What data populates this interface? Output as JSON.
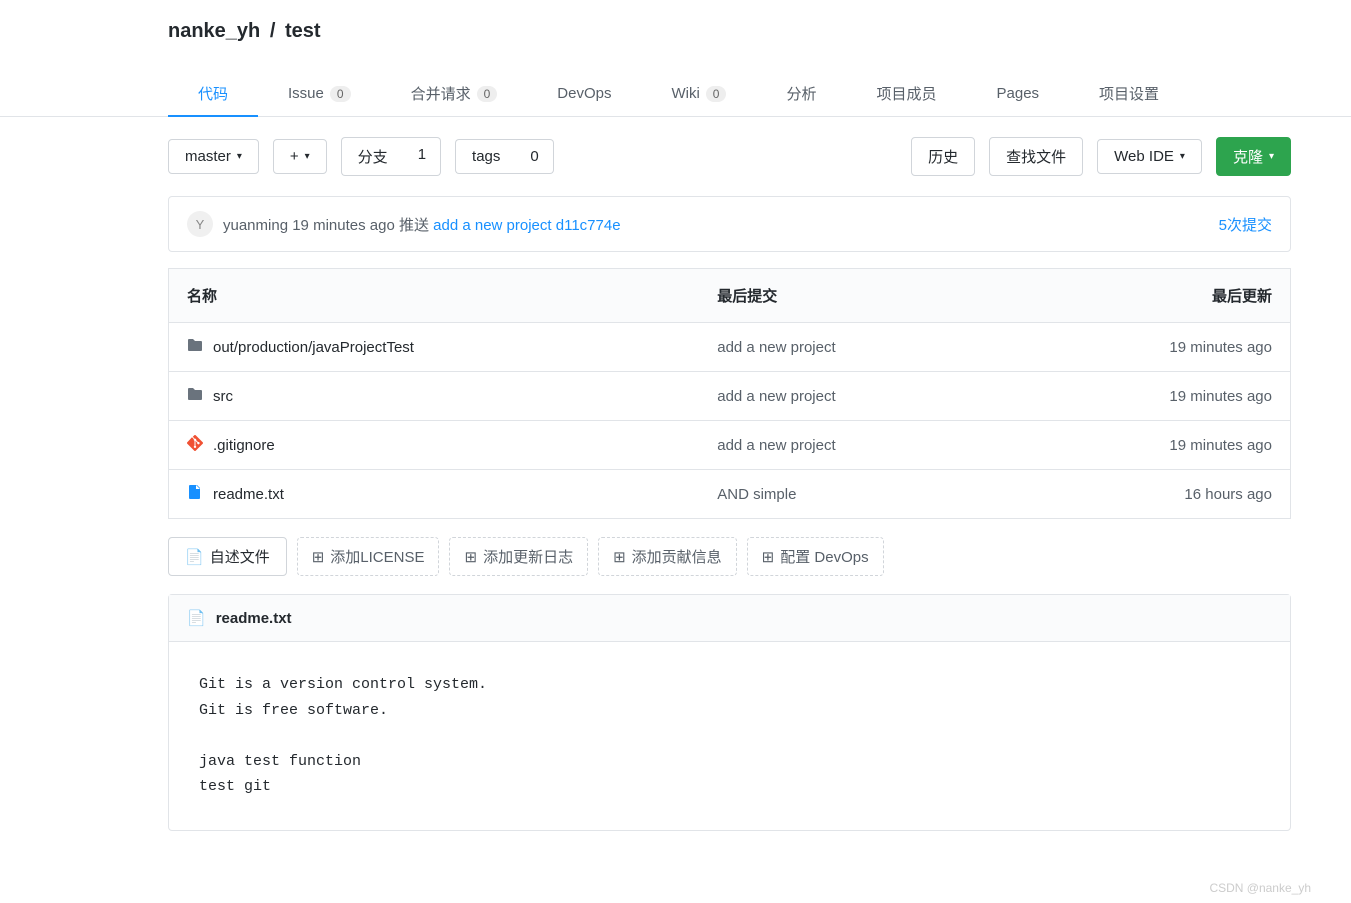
{
  "breadcrumb": {
    "owner": "nanke_yh",
    "sep": "/",
    "repo": "test"
  },
  "tabs": [
    {
      "label": "代码",
      "badge": null,
      "active": true
    },
    {
      "label": "Issue",
      "badge": "0"
    },
    {
      "label": "合并请求",
      "badge": "0"
    },
    {
      "label": "DevOps",
      "badge": null
    },
    {
      "label": "Wiki",
      "badge": "0"
    },
    {
      "label": "分析",
      "badge": null
    },
    {
      "label": "项目成员",
      "badge": null
    },
    {
      "label": "Pages",
      "badge": null
    },
    {
      "label": "项目设置",
      "badge": null
    }
  ],
  "toolbar": {
    "branch": "master",
    "plus": "+",
    "branch_label": "分支",
    "branch_count": "1",
    "tags_label": "tags",
    "tags_count": "0",
    "history": "历史",
    "find_file": "查找文件",
    "web_ide": "Web IDE",
    "clone": "克隆"
  },
  "commit": {
    "avatar": "Y",
    "author": "yuanming",
    "time": "19 minutes ago",
    "action": "推送",
    "msg": "add a new project",
    "hash": "d11c774e",
    "commits_link": "5次提交"
  },
  "table": {
    "headers": {
      "name": "名称",
      "last_commit": "最后提交",
      "updated": "最后更新"
    },
    "rows": [
      {
        "icon": "folder",
        "name": "out/production/javaProjectTest",
        "commit": "add a new project",
        "updated": "19 minutes ago"
      },
      {
        "icon": "folder",
        "name": "src",
        "commit": "add a new project",
        "updated": "19 minutes ago"
      },
      {
        "icon": "git",
        "name": ".gitignore",
        "commit": "add a new project",
        "updated": "19 minutes ago"
      },
      {
        "icon": "file",
        "name": "readme.txt",
        "commit": "AND simple",
        "updated": "16 hours ago"
      }
    ]
  },
  "actions": {
    "readme": "自述文件",
    "license": "添加LICENSE",
    "changelog": "添加更新日志",
    "contrib": "添加贡献信息",
    "devops": "配置 DevOps"
  },
  "readme": {
    "title": "readme.txt",
    "content": "Git is a version control system.\nGit is free software.\n\njava test function\ntest git"
  },
  "watermark": "CSDN @nanke_yh"
}
